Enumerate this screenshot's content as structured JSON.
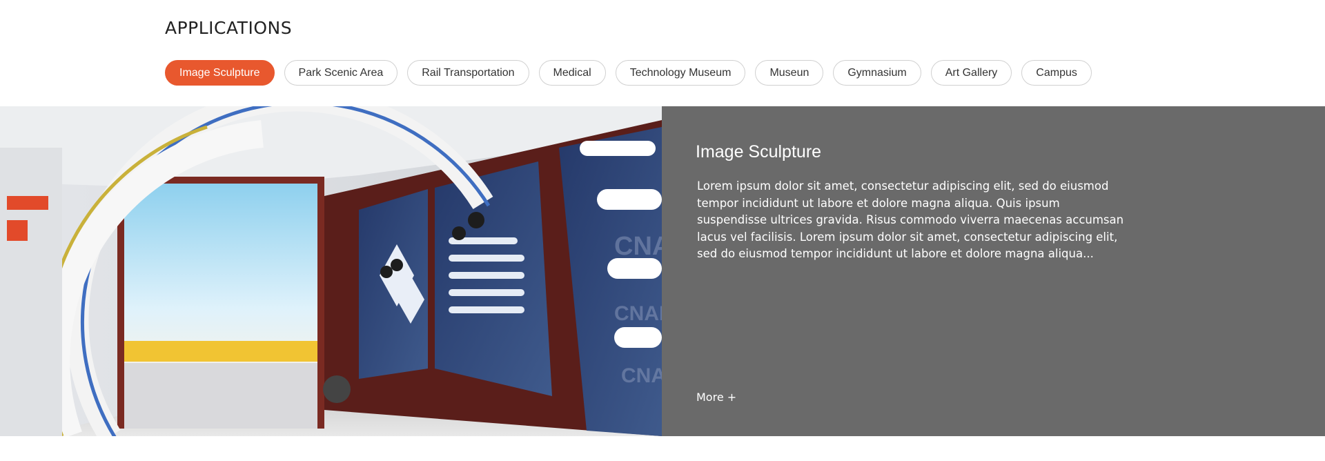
{
  "section": {
    "title": "APPLICATIONS"
  },
  "tabs": [
    {
      "label": "Image Sculpture",
      "active": true
    },
    {
      "label": "Park Scenic Area",
      "active": false
    },
    {
      "label": "Rail Transportation",
      "active": false
    },
    {
      "label": "Medical",
      "active": false
    },
    {
      "label": "Technology Museum",
      "active": false
    },
    {
      "label": "Museun",
      "active": false
    },
    {
      "label": "Gymnasium",
      "active": false
    },
    {
      "label": "Art Gallery",
      "active": false
    },
    {
      "label": "Campus",
      "active": false
    }
  ],
  "hero": {
    "image_description_icon": "exhibition-hall-photo",
    "image_texts": [
      "CNAF",
      "CNAF",
      "CNAF"
    ],
    "title": "Image Sculpture",
    "description": "Lorem ipsum dolor sit amet, consectetur adipiscing elit, sed do eiusmod tempor incididunt ut labore et dolore magna aliqua. Quis ipsum suspendisse ultrices gravida. Risus commodo viverra maecenas accumsan lacus vel facilisis. Lorem ipsum dolor sit amet, consectetur adipiscing elit, sed do eiusmod tempor incididunt ut labore et dolore magna aliqua...",
    "more_label": "More +"
  },
  "colors": {
    "accent": "#e8582e",
    "panel_bg": "#6a6a6a",
    "tab_border": "#d0d0d0"
  }
}
